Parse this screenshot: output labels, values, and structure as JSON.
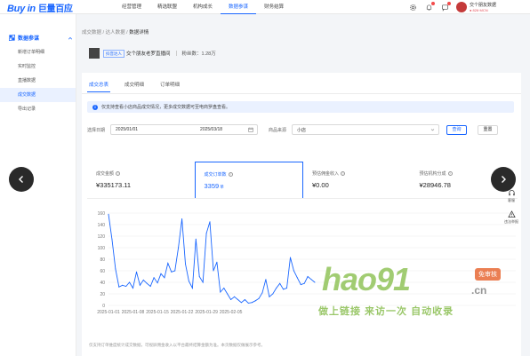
{
  "header": {
    "logo_text": "Buy in",
    "logo_cn": "巨量百应",
    "nav": [
      "经营管理",
      "精选联盟",
      "机构成长",
      "数据参谋",
      "财务结算"
    ],
    "nav_active_index": 3,
    "user_name": "交个朋友数据",
    "user_sub": "● 826·MCN"
  },
  "sidebar": {
    "section": "数据参谋",
    "items": [
      "新增订单明细",
      "实时监控",
      "直播数据",
      "成交数据",
      "导出记录"
    ],
    "active_index": 3
  },
  "breadcrumb": {
    "p1": "成交数据",
    "sep": "/",
    "p2": "达人数据",
    "p3": "数据详情"
  },
  "shop": {
    "tag": "抖音达人",
    "name": "交个朋友老罗直播间",
    "fans": "粉丝数：1.28万"
  },
  "tabs": [
    "成交总表",
    "成交明细",
    "订单明细"
  ],
  "tabs_active_index": 0,
  "notice": "仅支持查看小店商品成交情况，更多成交数据可至电商罗盘查看。",
  "filter": {
    "date_label": "选择日期",
    "date_start": "2025/01/01",
    "date_end": "2025/03/18",
    "source_label": "商品来源",
    "source_value": "小店",
    "query": "查询",
    "reset": "重置"
  },
  "metrics": [
    {
      "label": "成交金额",
      "value": "¥335173.11",
      "unit": ""
    },
    {
      "label": "成交订单数",
      "value": "3359",
      "unit": "单"
    },
    {
      "label": "预估佣金收入",
      "value": "¥0.00",
      "unit": ""
    },
    {
      "label": "预估机构分成",
      "value": "¥28946.78",
      "unit": ""
    }
  ],
  "metrics_active_index": 1,
  "footnote": "仅支持订单维度统计成交数据，可视屏佣金收入以平台最终结算金额为准。本页数据仅做展示参考。",
  "float_tools": [
    {
      "icon": "headset-icon",
      "label": "客服"
    },
    {
      "icon": "warning-icon",
      "label": "违法举报"
    }
  ],
  "watermark": {
    "logo": "hao91",
    "badge": "免审核",
    "domain": ".cn",
    "slogan": "做上链接 来访一次 自动收录"
  },
  "chart_data": {
    "type": "line",
    "x_ticks": [
      "2025-01-01",
      "2025-01-08",
      "2025-01-15",
      "2025-01-22",
      "2025-01-29",
      "2025-02-05"
    ],
    "y_ticks": [
      0,
      20,
      40,
      60,
      80,
      100,
      120,
      140,
      160
    ],
    "ylim": [
      0,
      160
    ],
    "series": [
      {
        "color": "#1966ff",
        "values": [
          158,
          115,
          63,
          32,
          35,
          33,
          40,
          30,
          58,
          35,
          44,
          38,
          33,
          48,
          39,
          55,
          48,
          73,
          58,
          60,
          100,
          150,
          72,
          42,
          30,
          115,
          50,
          40,
          125,
          145,
          60,
          75,
          23,
          30,
          20,
          10,
          15,
          10,
          5,
          10,
          4,
          5,
          8,
          12,
          22,
          45,
          15,
          20,
          30,
          38,
          28,
          30,
          83,
          60,
          48,
          36,
          38,
          50,
          45,
          40
        ]
      }
    ]
  }
}
